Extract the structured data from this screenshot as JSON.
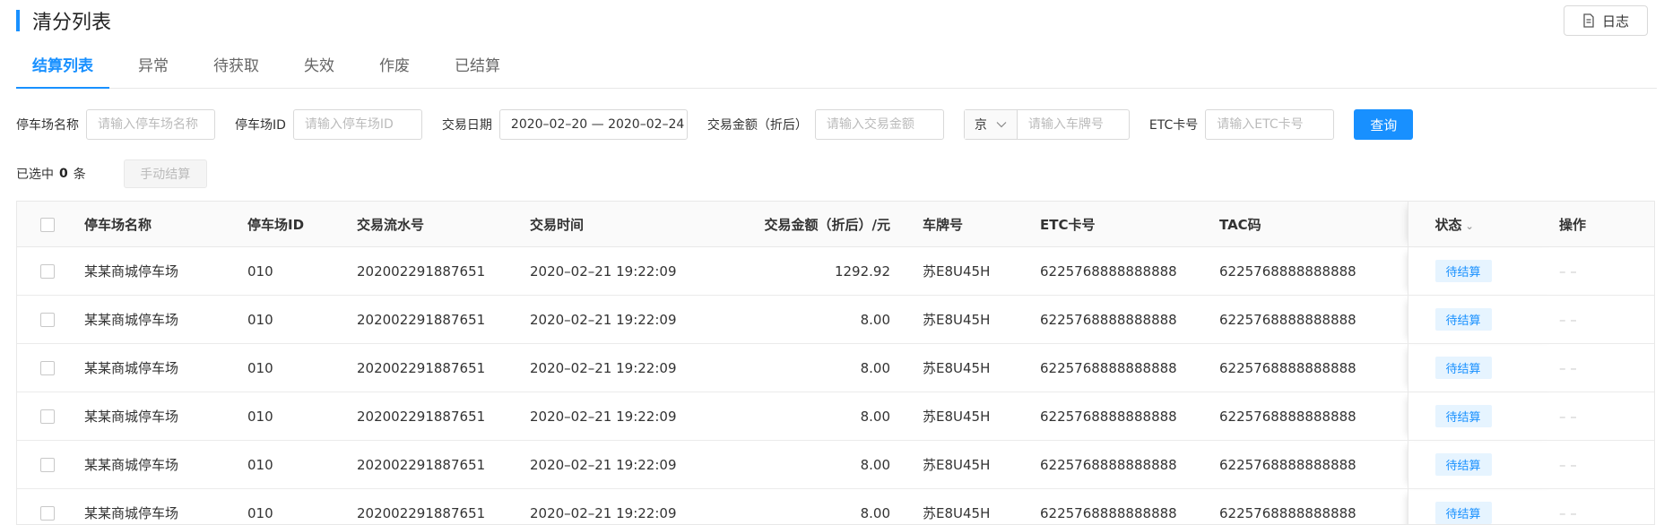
{
  "page": {
    "title": "清分列表",
    "log_button": "日志"
  },
  "tabs": [
    {
      "label": "结算列表",
      "active": true
    },
    {
      "label": "异常",
      "active": false
    },
    {
      "label": "待获取",
      "active": false
    },
    {
      "label": "失效",
      "active": false
    },
    {
      "label": "作废",
      "active": false
    },
    {
      "label": "已结算",
      "active": false
    }
  ],
  "filters": {
    "lot_name_label": "停车场名称",
    "lot_name_placeholder": "请输入停车场名称",
    "lot_id_label": "停车场ID",
    "lot_id_placeholder": "请输入停车场ID",
    "date_label": "交易日期",
    "date_value": "2020–02–20 — 2020–02–24",
    "amount_label": "交易金额（折后）",
    "amount_placeholder": "请输入交易金额",
    "plate_province": "京",
    "plate_placeholder": "请输入车牌号",
    "etc_label": "ETC卡号",
    "etc_placeholder": "请输入ETC卡号",
    "query_button": "查询"
  },
  "selection": {
    "prefix": "已选中",
    "count": "0",
    "suffix": "条",
    "manual_button": "手动结算"
  },
  "table": {
    "headers": [
      "停车场名称",
      "停车场ID",
      "交易流水号",
      "交易时间",
      "交易金额（折后）/元",
      "车牌号",
      "ETC卡号",
      "TAC码",
      "状态",
      "操作"
    ],
    "rows": [
      {
        "name": "某某商城停车场",
        "id": "010",
        "serial": "202002291887651",
        "time": "2020–02–21 19:22:09",
        "amount": "1292.92",
        "plate": "苏E8U45H",
        "etc": "6225768888888888",
        "tac": "6225768888888888",
        "status": "待结算",
        "action": "– –"
      },
      {
        "name": "某某商城停车场",
        "id": "010",
        "serial": "202002291887651",
        "time": "2020–02–21 19:22:09",
        "amount": "8.00",
        "plate": "苏E8U45H",
        "etc": "6225768888888888",
        "tac": "6225768888888888",
        "status": "待结算",
        "action": "– –"
      },
      {
        "name": "某某商城停车场",
        "id": "010",
        "serial": "202002291887651",
        "time": "2020–02–21 19:22:09",
        "amount": "8.00",
        "plate": "苏E8U45H",
        "etc": "6225768888888888",
        "tac": "6225768888888888",
        "status": "待结算",
        "action": "– –"
      },
      {
        "name": "某某商城停车场",
        "id": "010",
        "serial": "202002291887651",
        "time": "2020–02–21 19:22:09",
        "amount": "8.00",
        "plate": "苏E8U45H",
        "etc": "6225768888888888",
        "tac": "6225768888888888",
        "status": "待结算",
        "action": "– –"
      },
      {
        "name": "某某商城停车场",
        "id": "010",
        "serial": "202002291887651",
        "time": "2020–02–21 19:22:09",
        "amount": "8.00",
        "plate": "苏E8U45H",
        "etc": "6225768888888888",
        "tac": "6225768888888888",
        "status": "待结算",
        "action": "– –"
      },
      {
        "name": "某某商城停车场",
        "id": "010",
        "serial": "202002291887651",
        "time": "2020–02–21 19:22:09",
        "amount": "8.00",
        "plate": "苏E8U45H",
        "etc": "6225768888888888",
        "tac": "6225768888888888",
        "status": "待结算",
        "action": "– –"
      }
    ]
  },
  "colors": {
    "accent": "#1890ff",
    "badge_bg": "#e6f4ff"
  }
}
